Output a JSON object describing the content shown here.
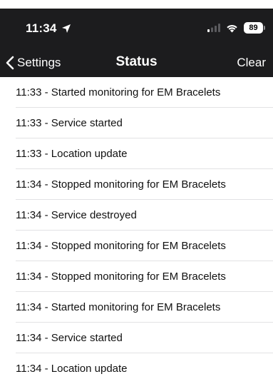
{
  "status_bar": {
    "time": "11:34",
    "battery": "89"
  },
  "nav": {
    "back_label": "Settings",
    "title": "Status",
    "clear_label": "Clear"
  },
  "log_entries": [
    "11:33 - Started monitoring for EM Bracelets",
    "11:33 - Service started",
    "11:33 - Location update",
    "11:34 - Stopped monitoring for EM Bracelets",
    "11:34 - Service destroyed",
    "11:34 - Stopped monitoring for EM Bracelets",
    "11:34 - Stopped monitoring for EM Bracelets",
    "11:34 - Started monitoring for EM Bracelets",
    "11:34 - Service started",
    "11:34 - Location update"
  ]
}
